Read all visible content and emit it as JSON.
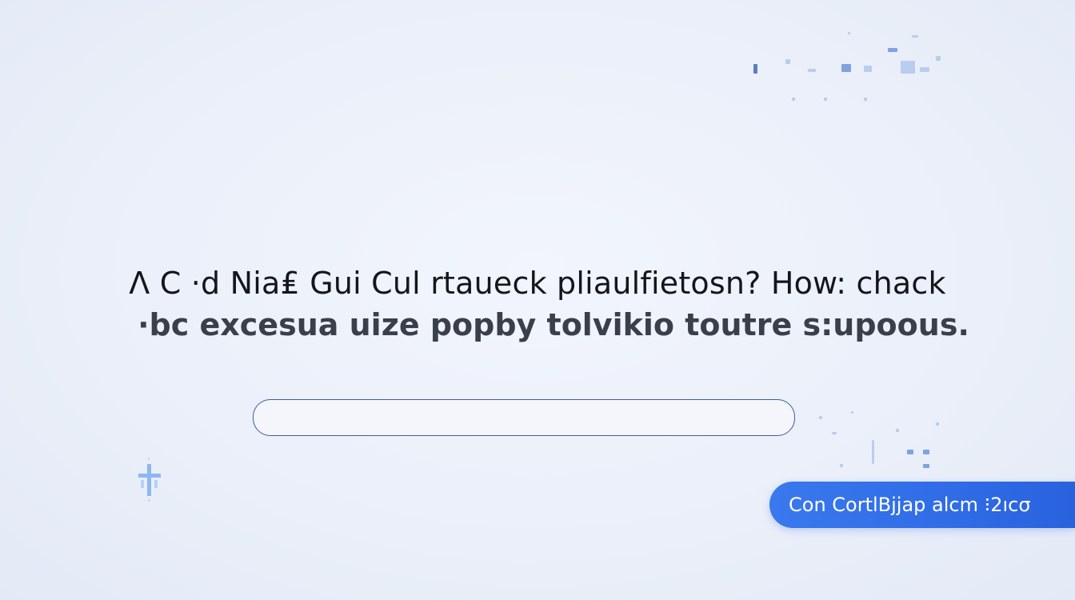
{
  "heading": {
    "line1": "Λ Ⅽ ·d Nia₤ Gui Cul rtaueck pliaulfietosn? How: chack",
    "line2": "·bc excesua uize popby tolvikio toutre s:upoous."
  },
  "input": {
    "value": "",
    "placeholder": ""
  },
  "cta_button": {
    "label": "Con CortlBjjap alcm ⁝2ıcσ"
  },
  "colors": {
    "background": "#eaeff9",
    "accent": "#2f6ce6",
    "input_border": "#3d5c9f",
    "text": "#14161c"
  },
  "icons": {
    "cross": "cross-icon",
    "pixel_cluster": "pixel-cluster-icon"
  }
}
